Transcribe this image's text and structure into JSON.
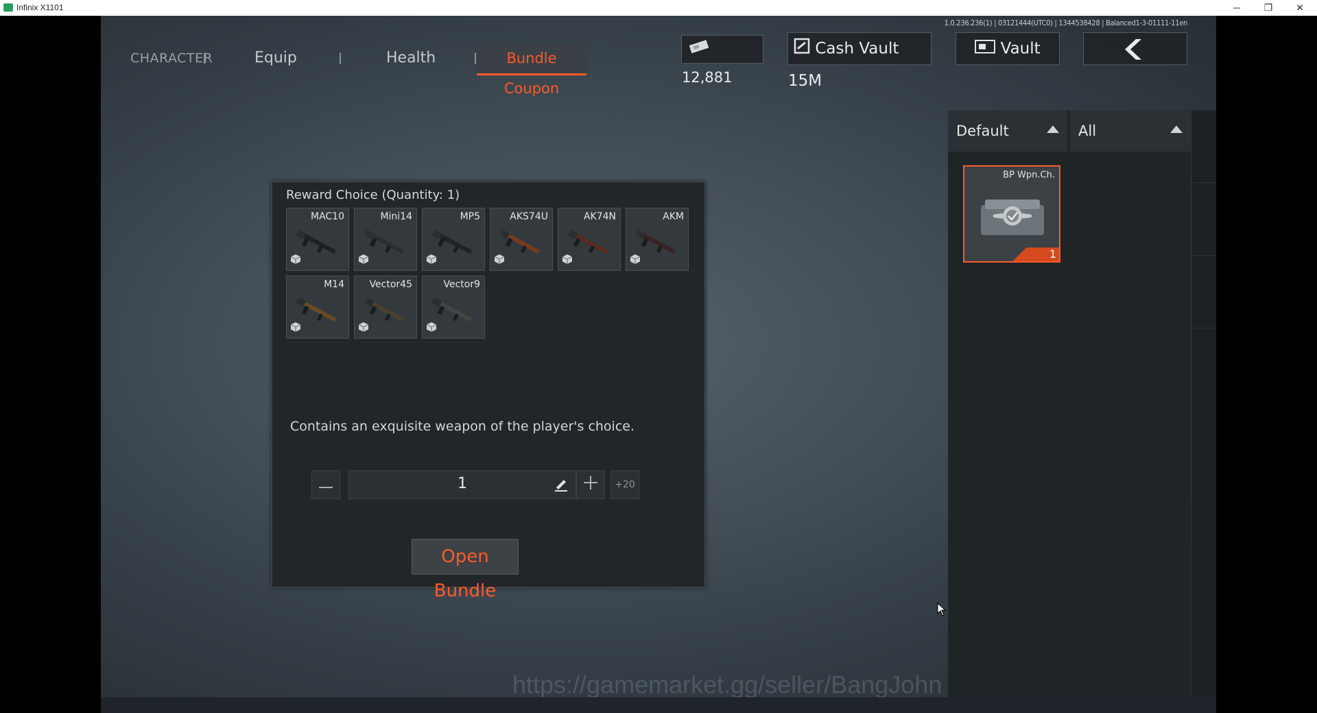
{
  "window": {
    "title": "Infinix X1101",
    "minimize": "─",
    "restore": "❐",
    "close": "✕"
  },
  "version": "1.0.236.236(1) | 03121444(UTC0) | 1344538428 | Balanced1-3-01111-11en",
  "tabs": [
    {
      "label": "CHARACTER"
    },
    {
      "label": "Equip"
    },
    {
      "label": "Health"
    },
    {
      "label": "Bundle Coupon",
      "active": true
    }
  ],
  "currency": {
    "amount": "12,881"
  },
  "cash_vault_button": "Cash Vault 15M",
  "vault_button": "Vault",
  "dialog": {
    "title": "Reward Choice (Quantity: 1)",
    "weapons": [
      {
        "name": "MAC10"
      },
      {
        "name": "Mini14"
      },
      {
        "name": "MP5"
      },
      {
        "name": "AKS74U"
      },
      {
        "name": "AK74N"
      },
      {
        "name": "AKM"
      },
      {
        "name": "M14"
      },
      {
        "name": "Vector45"
      },
      {
        "name": "Vector9"
      }
    ],
    "description": "Contains an exquisite weapon of the player's choice.",
    "quantity": "1",
    "plus20": "+20",
    "open_button": "Open Bundle"
  },
  "filters": {
    "sort": "Default",
    "category": "All"
  },
  "inventory": [
    {
      "name": "BP Wpn.Ch.",
      "count": "1"
    }
  ],
  "side_icons": [
    "chest-icon",
    "card-icon",
    "gift-icon"
  ],
  "watermark": "https://gamemarket.gg/seller/BangJohn",
  "colors": {
    "accent": "#ff5a2a",
    "panel": "#222629"
  }
}
